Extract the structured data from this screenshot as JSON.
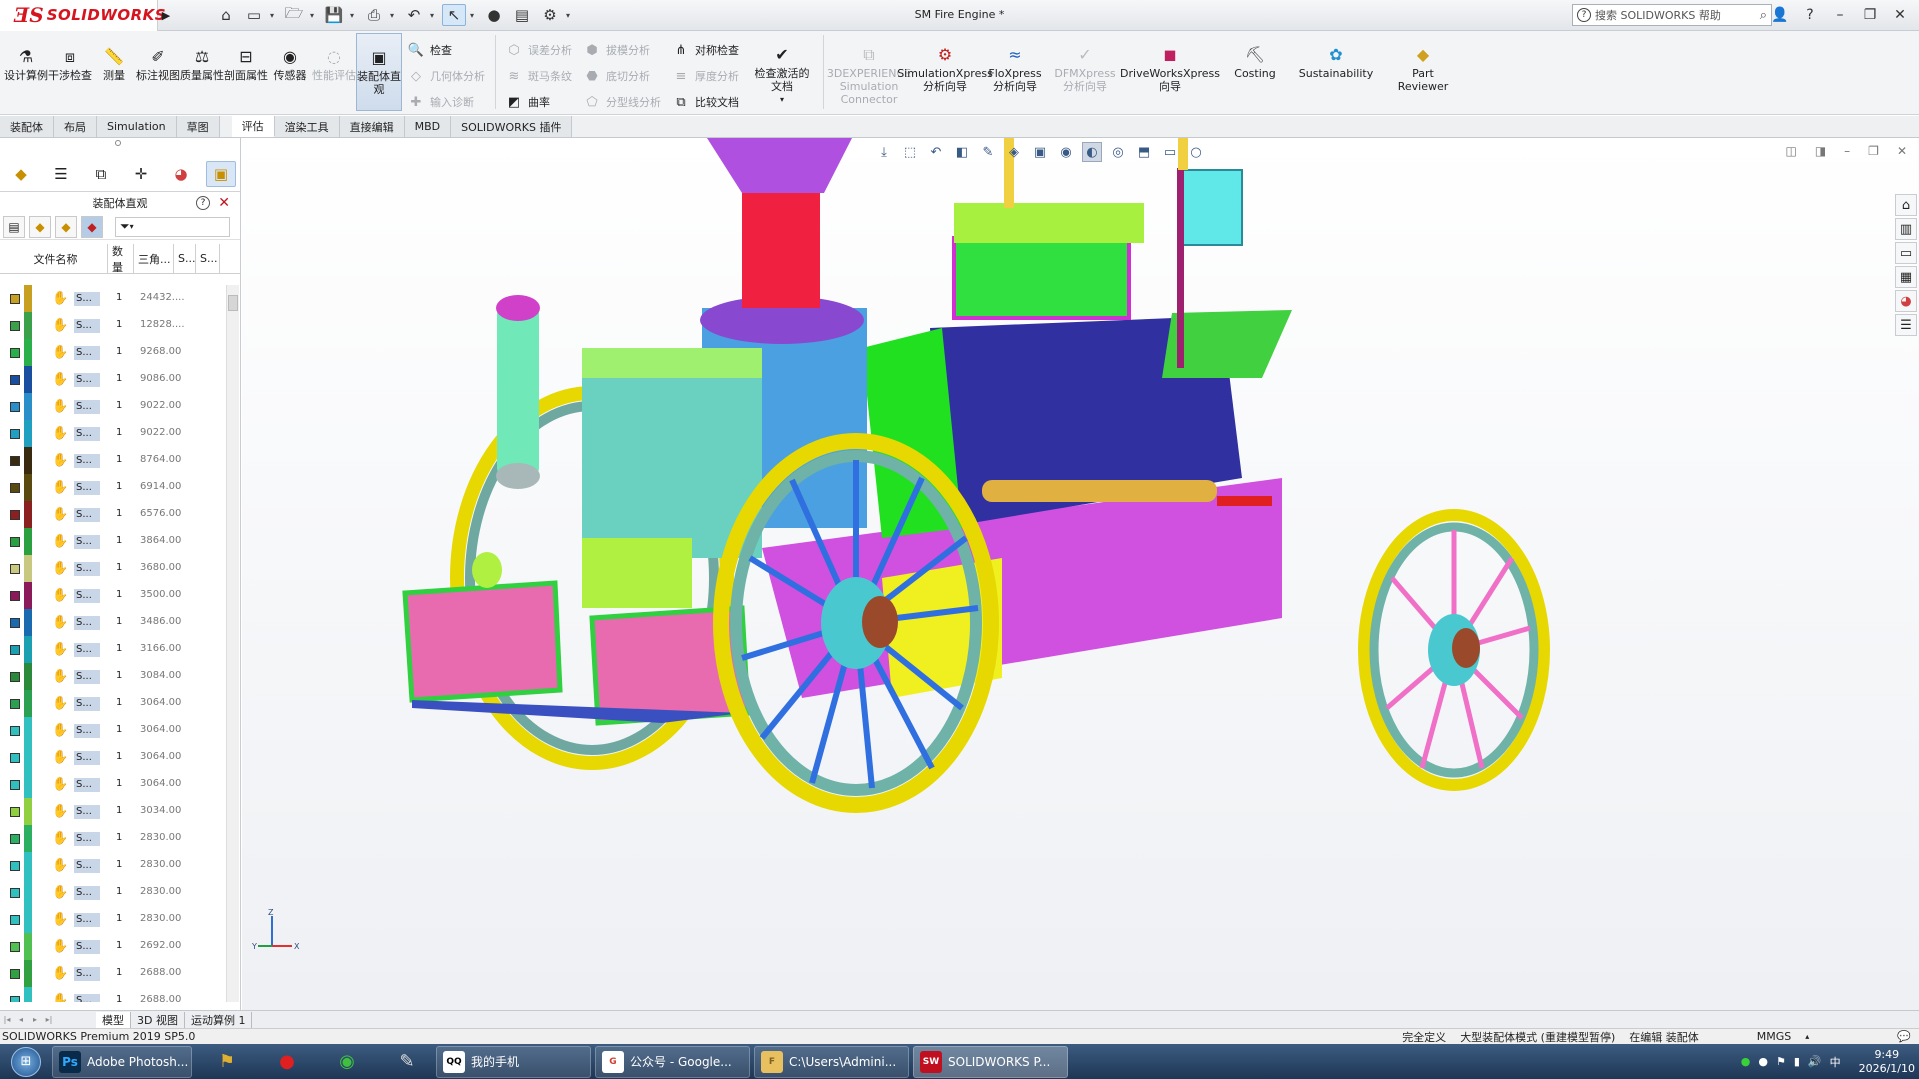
{
  "titlebar": {
    "logo_ds": "ƎS",
    "logo_text": "SOLIDWORKS",
    "document_title": "SM Fire Engine *",
    "search_placeholder": "搜索 SOLIDWORKS 帮助"
  },
  "ribbon": {
    "buttons": [
      {
        "label": "设计算例",
        "icon": "design-study-icon",
        "disabled": false
      },
      {
        "label": "干涉检查",
        "icon": "interference-icon",
        "disabled": false
      },
      {
        "label": "测量",
        "icon": "measure-icon",
        "disabled": false
      },
      {
        "label": "标注视图",
        "icon": "markup-icon",
        "disabled": false
      },
      {
        "label": "质量属性",
        "icon": "mass-properties-icon",
        "disabled": false
      },
      {
        "label": "剖面属性",
        "icon": "section-properties-icon",
        "disabled": false
      },
      {
        "label": "传感器",
        "icon": "sensor-icon",
        "disabled": false
      },
      {
        "label": "性能评估",
        "icon": "performance-icon",
        "disabled": true
      },
      {
        "label": "装配体直观",
        "icon": "assembly-visualization-icon",
        "disabled": false,
        "selected": true
      }
    ],
    "col1": [
      {
        "label": "检查",
        "disabled": false
      },
      {
        "label": "几何体分析",
        "disabled": true
      },
      {
        "label": "输入诊断",
        "disabled": true
      }
    ],
    "col2": [
      {
        "label": "误差分析",
        "disabled": true
      },
      {
        "label": "斑马条纹",
        "disabled": true
      },
      {
        "label": "曲率",
        "disabled": false
      }
    ],
    "col3": [
      {
        "label": "拔模分析",
        "disabled": true
      },
      {
        "label": "底切分析",
        "disabled": true
      },
      {
        "label": "分型线分析",
        "disabled": true
      }
    ],
    "col4": [
      {
        "label": "对称检查",
        "disabled": false
      },
      {
        "label": "厚度分析",
        "disabled": true
      },
      {
        "label": "比较文档",
        "disabled": false
      }
    ],
    "check_active": "检查激活的文档",
    "addins": [
      {
        "label": "3DEXPERIENCE Simulation Connector",
        "disabled": true
      },
      {
        "label": "SimulationXpress 分析向导",
        "disabled": false
      },
      {
        "label": "FloXpress 分析向导",
        "disabled": false
      },
      {
        "label": "DFMXpress 分析向导",
        "disabled": true
      },
      {
        "label": "DriveWorksXpress 向导",
        "disabled": false
      },
      {
        "label": "Costing",
        "disabled": false
      },
      {
        "label": "Sustainability",
        "disabled": false
      },
      {
        "label": "Part Reviewer",
        "disabled": false
      }
    ]
  },
  "tabs": [
    "装配体",
    "布局",
    "Simulation",
    "草图",
    "评估",
    "渲染工具",
    "直接编辑",
    "MBD",
    "SOLIDWORKS 插件"
  ],
  "active_tab": "评估",
  "panel": {
    "title": "装配体直观",
    "columns": [
      "文件名称",
      "数量",
      "三角...",
      "S...",
      "S..."
    ],
    "rows": [
      {
        "name": "S...",
        "qty": "1",
        "value": "24432....",
        "color": "#c8a020"
      },
      {
        "name": "S...",
        "qty": "1",
        "value": "12828....",
        "color": "#3aa04a"
      },
      {
        "name": "S...",
        "qty": "1",
        "value": "9268.00",
        "color": "#2ab04a"
      },
      {
        "name": "S...",
        "qty": "1",
        "value": "9086.00",
        "color": "#1a4fa0"
      },
      {
        "name": "S...",
        "qty": "1",
        "value": "9022.00",
        "color": "#2a8fc8"
      },
      {
        "name": "S...",
        "qty": "1",
        "value": "9022.00",
        "color": "#1fa0c0"
      },
      {
        "name": "S...",
        "qty": "1",
        "value": "8764.00",
        "color": "#3a2a10"
      },
      {
        "name": "S...",
        "qty": "1",
        "value": "6914.00",
        "color": "#5a4a10"
      },
      {
        "name": "S...",
        "qty": "1",
        "value": "6576.00",
        "color": "#8a2020"
      },
      {
        "name": "S...",
        "qty": "1",
        "value": "3864.00",
        "color": "#2aa040"
      },
      {
        "name": "S...",
        "qty": "1",
        "value": "3680.00",
        "color": "#c8c880"
      },
      {
        "name": "S...",
        "qty": "1",
        "value": "3500.00",
        "color": "#8a1a5a"
      },
      {
        "name": "S...",
        "qty": "1",
        "value": "3486.00",
        "color": "#1a6ab0"
      },
      {
        "name": "S...",
        "qty": "1",
        "value": "3166.00",
        "color": "#1aa0b0"
      },
      {
        "name": "S...",
        "qty": "1",
        "value": "3084.00",
        "color": "#2a8a3a"
      },
      {
        "name": "S...",
        "qty": "1",
        "value": "3064.00",
        "color": "#2aa050"
      },
      {
        "name": "S...",
        "qty": "1",
        "value": "3064.00",
        "color": "#30c0c0"
      },
      {
        "name": "S...",
        "qty": "1",
        "value": "3064.00",
        "color": "#30c0c0"
      },
      {
        "name": "S...",
        "qty": "1",
        "value": "3064.00",
        "color": "#30c0c0"
      },
      {
        "name": "S...",
        "qty": "1",
        "value": "3034.00",
        "color": "#90d040"
      },
      {
        "name": "S...",
        "qty": "1",
        "value": "2830.00",
        "color": "#2ab060"
      },
      {
        "name": "S...",
        "qty": "1",
        "value": "2830.00",
        "color": "#30c0c0"
      },
      {
        "name": "S...",
        "qty": "1",
        "value": "2830.00",
        "color": "#30c0c0"
      },
      {
        "name": "S...",
        "qty": "1",
        "value": "2830.00",
        "color": "#30c0c0"
      },
      {
        "name": "S...",
        "qty": "1",
        "value": "2692.00",
        "color": "#50c050"
      },
      {
        "name": "S...",
        "qty": "1",
        "value": "2688.00",
        "color": "#30a040"
      },
      {
        "name": "S...",
        "qty": "1",
        "value": "2688.00",
        "color": "#30c0c0"
      }
    ]
  },
  "bottom_tabs": [
    "模型",
    "3D 视图",
    "运动算例 1"
  ],
  "status": {
    "product": "SOLIDWORKS Premium 2019 SP5.0",
    "defined": "完全定义",
    "mode": "大型装配体模式 (重建模型暂停)",
    "editing": "在编辑 装配体",
    "units": "MMGS"
  },
  "taskbar": {
    "apps": [
      {
        "label": "Adobe Photosh...",
        "icon": "Ps"
      },
      {
        "label": "我的手机",
        "icon": "QQ"
      },
      {
        "label": "公众号 - Google...",
        "icon": "G"
      },
      {
        "label": "C:\\Users\\Admini...",
        "icon": "F"
      },
      {
        "label": "SOLIDWORKS P...",
        "icon": "SW",
        "active": true
      }
    ],
    "time": "9:49",
    "date": "2026/1/10"
  },
  "triad": {
    "z": "Z",
    "y": "Y",
    "x": "X"
  }
}
